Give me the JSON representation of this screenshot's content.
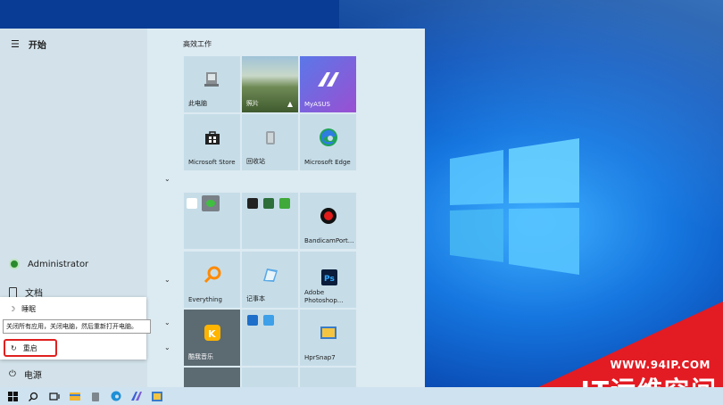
{
  "start_menu": {
    "title": "开始",
    "section_title": "高效工作",
    "user": "Administrator",
    "documents": "文档",
    "power": "电源"
  },
  "power_flyout": {
    "sleep": "睡眠",
    "restart": "重启",
    "tooltip": "关闭所有应用，关闭电脑，然后重新打开电脑。"
  },
  "tiles": {
    "this_pc": "此电脑",
    "photos": "照片",
    "myasus": "MyASUS",
    "store": "Microsoft Store",
    "recycle": "回收站",
    "edge": "Microsoft Edge",
    "bandicam": "BandicamPort...",
    "everything": "Everything",
    "notepad": "记事本",
    "photoshop": "Adobe Photoshop...",
    "kugou": "酷我音乐",
    "hprsnap": "HprSnap7"
  },
  "watermark": {
    "url": "WWW.94IP.COM",
    "brand": "IT运维空间"
  },
  "colors": {
    "restart_highlight": "#e02020",
    "watermark_red": "#e31b23",
    "myasus_purple": "#7b5cd6"
  }
}
